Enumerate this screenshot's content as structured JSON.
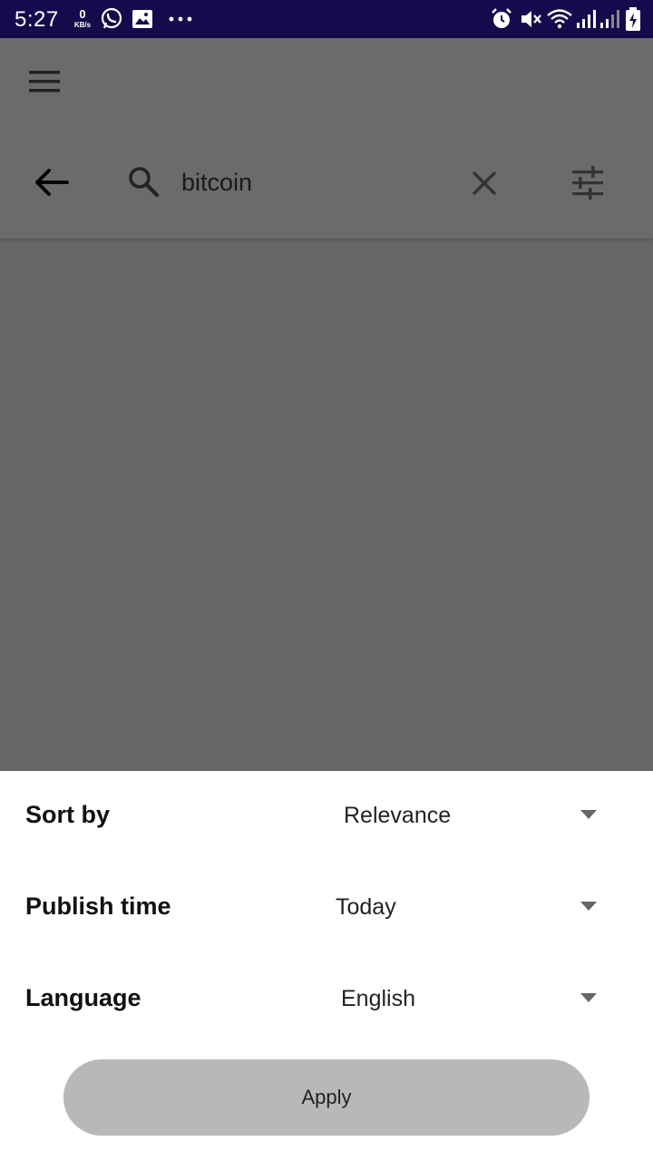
{
  "status_bar": {
    "time": "5:27",
    "net_speed_value": "0",
    "net_speed_unit": "KB/s",
    "left_icons": [
      "whatsapp-icon",
      "gallery-icon",
      "more-dots-icon"
    ],
    "right_icons": [
      "alarm-icon",
      "mute-icon",
      "wifi-icon",
      "signal-icon",
      "signal-icon-2",
      "battery-charging-icon"
    ],
    "background": "#160a4c"
  },
  "header": {
    "menu_icon": "hamburger-icon",
    "back_icon": "arrow-left-icon",
    "search_icon": "search-icon",
    "search_value": "bitcoin",
    "clear_icon": "close-icon",
    "filter_icon": "tune-icon"
  },
  "filters": {
    "sort_by": {
      "label": "Sort by",
      "value": "Relevance"
    },
    "publish_time": {
      "label": "Publish time",
      "value": "Today"
    },
    "language": {
      "label": "Language",
      "value": "English"
    }
  },
  "apply_label": "Apply",
  "colors": {
    "scrim": "#666666",
    "sheet": "#ffffff",
    "apply_button": "#b8b8b8"
  }
}
